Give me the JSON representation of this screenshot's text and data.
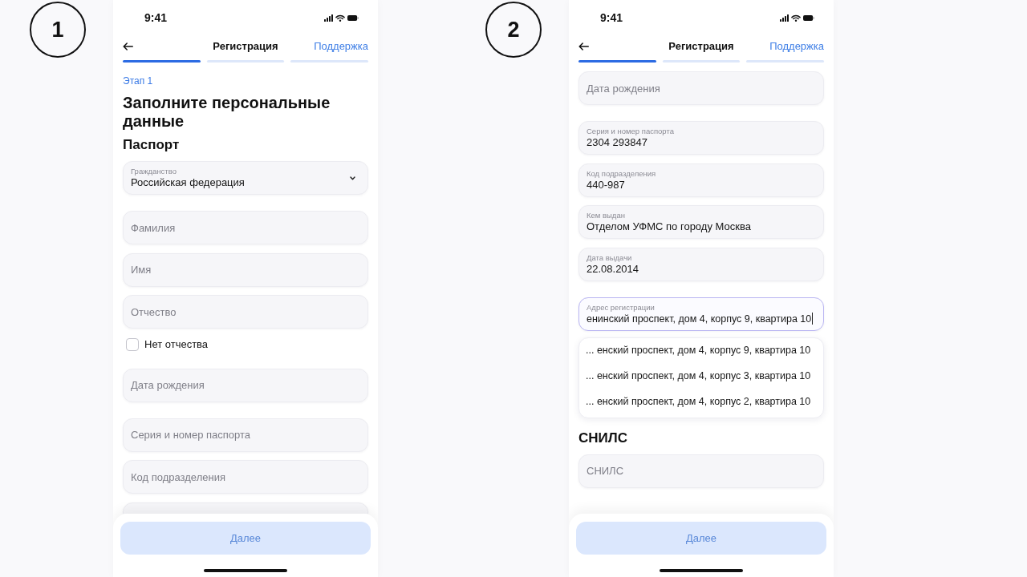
{
  "screens": [
    {
      "marker": "1",
      "status_bar": {
        "time": "9:41"
      },
      "nav": {
        "title": "Регистрация",
        "action": "Поддержка"
      },
      "progress": [
        {
          "active": true
        },
        {
          "active": false
        },
        {
          "active": false
        }
      ],
      "content": [
        {
          "kind": "step_label",
          "text": "Этап 1"
        },
        {
          "kind": "heading",
          "text": "Заполните персональные данные"
        },
        {
          "kind": "section_title",
          "text": "Паспорт"
        },
        {
          "kind": "group",
          "fields": [
            {
              "kind": "select",
              "label": "Гражданство",
              "value": "Российская федерация",
              "focused": false
            }
          ]
        },
        {
          "kind": "group",
          "fields": [
            {
              "kind": "input",
              "placeholder": "Фамилия",
              "focused": false
            },
            {
              "kind": "input",
              "placeholder": "Имя",
              "focused": false
            },
            {
              "kind": "input",
              "placeholder": "Отчество",
              "focused": false
            }
          ]
        },
        {
          "kind": "checkbox",
          "label": "Нет отчества",
          "checked": false
        },
        {
          "kind": "group",
          "fields": [
            {
              "kind": "input",
              "placeholder": "Дата рождения",
              "focused": false
            }
          ]
        },
        {
          "kind": "group",
          "fields": [
            {
              "kind": "input",
              "placeholder": "Серия и номер паспорта",
              "focused": false
            },
            {
              "kind": "input",
              "placeholder": "Код подразделения",
              "focused": false
            },
            {
              "kind": "input",
              "focused": false
            }
          ]
        }
      ],
      "footer": {
        "button": {
          "label": "Далее",
          "disabled": true
        }
      }
    },
    {
      "marker": "2",
      "status_bar": {
        "time": "9:41"
      },
      "nav": {
        "title": "Регистрация",
        "action": "Поддержка"
      },
      "progress": [
        {
          "active": true
        },
        {
          "active": false
        },
        {
          "active": false
        }
      ],
      "content": [
        {
          "kind": "group",
          "fields": [
            {
              "kind": "input",
              "placeholder": "Дата рождения",
              "focused": false
            }
          ]
        },
        {
          "kind": "group",
          "fields": [
            {
              "kind": "input",
              "label": "Серия и номер паспорта",
              "value": "2304 293847",
              "focused": false
            },
            {
              "kind": "input",
              "label": "Код подразделения",
              "value": "440-987",
              "focused": false
            },
            {
              "kind": "input",
              "label": "Кем выдан",
              "value": "Отделом УФМС по городу Москва",
              "focused": false
            },
            {
              "kind": "input",
              "label": "Дата выдачи",
              "value": "22.08.2014",
              "focused": false
            }
          ]
        },
        {
          "kind": "group",
          "fields": [
            {
              "kind": "input",
              "label": "Адрес регистрации",
              "value": "енинский проспект, дом 4, корпус 9, квартира 10",
              "focused": true,
              "suggestions": [
                "... енский проспект, дом 4, корпус 9, квартира 10",
                "... енский проспект, дом 4, корпус 3, квартира 10",
                "... енский проспект, дом 4, корпус 2, квартира 10"
              ]
            }
          ]
        },
        {
          "kind": "section_title",
          "text": "СНИЛС"
        },
        {
          "kind": "group",
          "fields": [
            {
              "kind": "input",
              "placeholder": "СНИЛС",
              "focused": false
            }
          ]
        }
      ],
      "footer": {
        "button": {
          "label": "Далее",
          "disabled": true
        }
      }
    }
  ]
}
